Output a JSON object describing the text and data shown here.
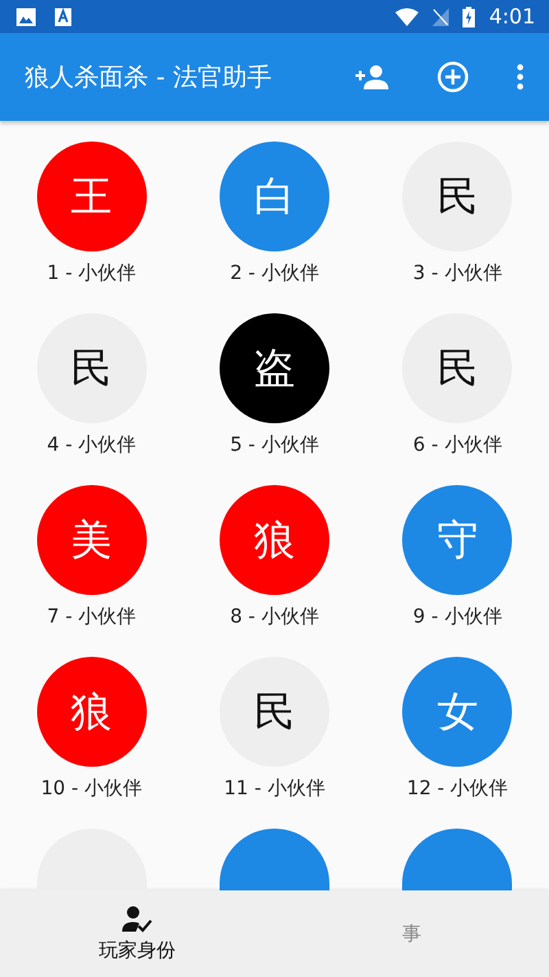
{
  "status_bar": {
    "time": "4:01"
  },
  "app_bar": {
    "title": "狼人杀面杀 - 法官助手"
  },
  "players": [
    {
      "role": "王",
      "label": "1 - 小伙伴",
      "color": "#ff0000"
    },
    {
      "role": "白",
      "label": "2 - 小伙伴",
      "color": "#1e88e5"
    },
    {
      "role": "民",
      "label": "3 - 小伙伴",
      "color": "#eeeeee"
    },
    {
      "role": "民",
      "label": "4 - 小伙伴",
      "color": "#eeeeee"
    },
    {
      "role": "盗",
      "label": "5 - 小伙伴",
      "color": "#000000"
    },
    {
      "role": "民",
      "label": "6 - 小伙伴",
      "color": "#eeeeee"
    },
    {
      "role": "美",
      "label": "7 - 小伙伴",
      "color": "#ff0000"
    },
    {
      "role": "狼",
      "label": "8 - 小伙伴",
      "color": "#ff0000"
    },
    {
      "role": "守",
      "label": "9 - 小伙伴",
      "color": "#1e88e5"
    },
    {
      "role": "狼",
      "label": "10 - 小伙伴",
      "color": "#ff0000"
    },
    {
      "role": "民",
      "label": "11 - 小伙伴",
      "color": "#eeeeee"
    },
    {
      "role": "女",
      "label": "12 - 小伙伴",
      "color": "#1e88e5"
    },
    {
      "color": "#eeeeee"
    },
    {
      "color": "#1e88e5"
    },
    {
      "color": "#1e88e5"
    }
  ],
  "bottom_nav": [
    {
      "label": "玩家身份",
      "selected": true
    },
    {
      "label": "事",
      "selected": false
    }
  ]
}
